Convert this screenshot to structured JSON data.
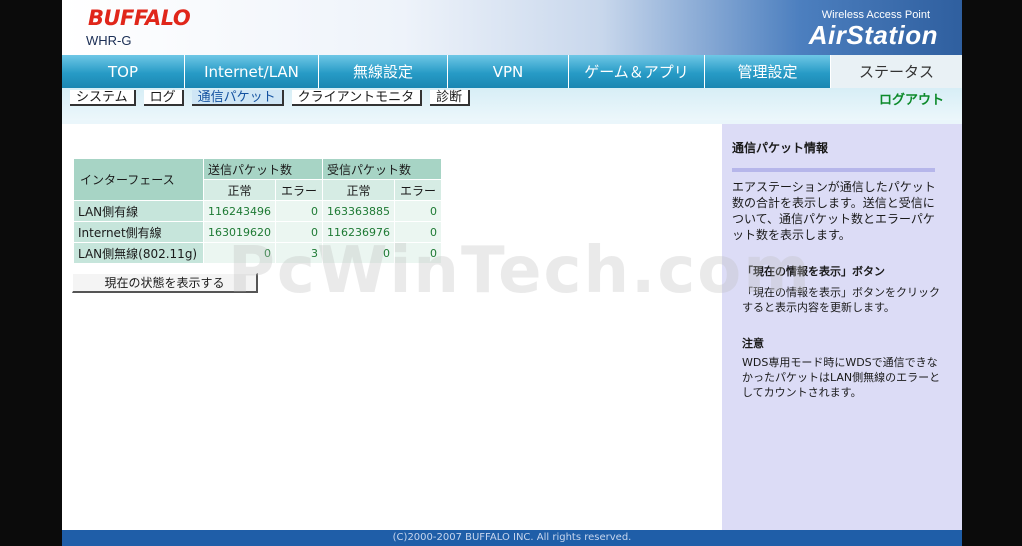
{
  "header": {
    "brand": "BUFFALO",
    "model": "WHR-G",
    "product_sub": "Wireless Access Point",
    "product_name": "AirStation"
  },
  "nav": {
    "tabs": [
      {
        "label": "TOP"
      },
      {
        "label": "Internet/LAN"
      },
      {
        "label": "無線設定"
      },
      {
        "label": "VPN"
      },
      {
        "label": "ゲーム＆アプリ"
      },
      {
        "label": "管理設定"
      },
      {
        "label": "ステータス",
        "active": true
      }
    ]
  },
  "subnav": {
    "items": [
      {
        "label": "システム"
      },
      {
        "label": "ログ"
      },
      {
        "label": "通信パケット",
        "active": true
      },
      {
        "label": "クライアントモニタ"
      },
      {
        "label": "診断"
      }
    ],
    "logout": "ログアウト"
  },
  "table": {
    "interface_header": "インターフェース",
    "send_header": "送信パケット数",
    "recv_header": "受信パケット数",
    "normal": "正常",
    "error": "エラー",
    "rows": [
      {
        "label": "LAN側有線",
        "send_ok": "116243496",
        "send_err": "0",
        "recv_ok": "163363885",
        "recv_err": "0"
      },
      {
        "label": "Internet側有線",
        "send_ok": "163019620",
        "send_err": "0",
        "recv_ok": "116236976",
        "recv_err": "0"
      },
      {
        "label": "LAN側無線(802.11g)",
        "send_ok": "0",
        "send_err": "3",
        "recv_ok": "0",
        "recv_err": "0"
      }
    ]
  },
  "refresh_button": "現在の状態を表示する",
  "help": {
    "title": "通信パケット情報",
    "desc": "エアステーションが通信したパケット数の合計を表示します。送信と受信について、通信パケット数とエラーパケット数を表示します。",
    "button_title": "「現在の情報を表示」ボタン",
    "button_desc": "「現在の情報を表示」ボタンをクリックすると表示内容を更新します。",
    "note_title": "注意",
    "note_desc": "WDS専用モード時にWDSで通信できなかったパケットはLAN側無線のエラーとしてカウントされます。"
  },
  "footer": "(C)2000-2007 BUFFALO INC. All rights reserved.",
  "watermark": "PcWinTech.com"
}
